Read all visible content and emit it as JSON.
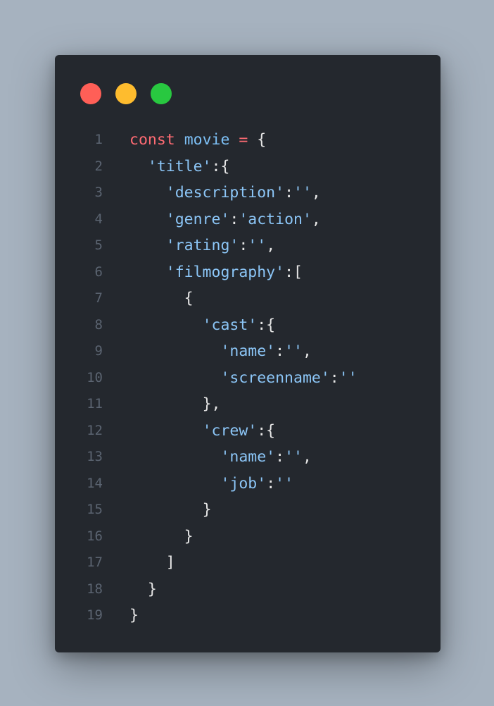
{
  "window": {
    "controls": [
      {
        "name": "close-dot",
        "color": "#ff5f57"
      },
      {
        "name": "minimize-dot",
        "color": "#febc2e"
      },
      {
        "name": "maximize-dot",
        "color": "#28c840"
      }
    ]
  },
  "colors": {
    "keyword": "#ff6b73",
    "variable": "#7dc0f6",
    "string": "#8cc6f7",
    "punctuation": "#e6e6e6",
    "line_number": "#5b6471",
    "background": "#24282e",
    "page_background": "#a6b2bf"
  },
  "code": {
    "language": "javascript",
    "lines": [
      {
        "number": "1",
        "indent": "",
        "tokens": [
          {
            "t": "const",
            "k": "keyword"
          },
          {
            "t": " ",
            "k": "punct"
          },
          {
            "t": "movie",
            "k": "variable"
          },
          {
            "t": " ",
            "k": "punct"
          },
          {
            "t": "=",
            "k": "operator"
          },
          {
            "t": " {",
            "k": "punct"
          }
        ]
      },
      {
        "number": "2",
        "indent": "  ",
        "tokens": [
          {
            "t": "'title'",
            "k": "string"
          },
          {
            "t": ":{",
            "k": "punct"
          }
        ]
      },
      {
        "number": "3",
        "indent": "    ",
        "tokens": [
          {
            "t": "'description'",
            "k": "string"
          },
          {
            "t": ":",
            "k": "punct"
          },
          {
            "t": "''",
            "k": "string"
          },
          {
            "t": ",",
            "k": "punct"
          }
        ]
      },
      {
        "number": "4",
        "indent": "    ",
        "tokens": [
          {
            "t": "'genre'",
            "k": "string"
          },
          {
            "t": ":",
            "k": "punct"
          },
          {
            "t": "'action'",
            "k": "string"
          },
          {
            "t": ",",
            "k": "punct"
          }
        ]
      },
      {
        "number": "5",
        "indent": "    ",
        "tokens": [
          {
            "t": "'rating'",
            "k": "string"
          },
          {
            "t": ":",
            "k": "punct"
          },
          {
            "t": "''",
            "k": "string"
          },
          {
            "t": ",",
            "k": "punct"
          }
        ]
      },
      {
        "number": "6",
        "indent": "    ",
        "tokens": [
          {
            "t": "'filmography'",
            "k": "string"
          },
          {
            "t": ":[",
            "k": "punct"
          }
        ]
      },
      {
        "number": "7",
        "indent": "      ",
        "tokens": [
          {
            "t": "{",
            "k": "punct"
          }
        ]
      },
      {
        "number": "8",
        "indent": "        ",
        "tokens": [
          {
            "t": "'cast'",
            "k": "string"
          },
          {
            "t": ":{",
            "k": "punct"
          }
        ]
      },
      {
        "number": "9",
        "indent": "          ",
        "tokens": [
          {
            "t": "'name'",
            "k": "string"
          },
          {
            "t": ":",
            "k": "punct"
          },
          {
            "t": "''",
            "k": "string"
          },
          {
            "t": ",",
            "k": "punct"
          }
        ]
      },
      {
        "number": "10",
        "indent": "          ",
        "tokens": [
          {
            "t": "'screenname'",
            "k": "string"
          },
          {
            "t": ":",
            "k": "punct"
          },
          {
            "t": "''",
            "k": "string"
          }
        ]
      },
      {
        "number": "11",
        "indent": "        ",
        "tokens": [
          {
            "t": "},",
            "k": "punct"
          }
        ]
      },
      {
        "number": "12",
        "indent": "        ",
        "tokens": [
          {
            "t": "'crew'",
            "k": "string"
          },
          {
            "t": ":{",
            "k": "punct"
          }
        ]
      },
      {
        "number": "13",
        "indent": "          ",
        "tokens": [
          {
            "t": "'name'",
            "k": "string"
          },
          {
            "t": ":",
            "k": "punct"
          },
          {
            "t": "''",
            "k": "string"
          },
          {
            "t": ",",
            "k": "punct"
          }
        ]
      },
      {
        "number": "14",
        "indent": "          ",
        "tokens": [
          {
            "t": "'job'",
            "k": "string"
          },
          {
            "t": ":",
            "k": "punct"
          },
          {
            "t": "''",
            "k": "string"
          }
        ]
      },
      {
        "number": "15",
        "indent": "        ",
        "tokens": [
          {
            "t": "}",
            "k": "punct"
          }
        ]
      },
      {
        "number": "16",
        "indent": "      ",
        "tokens": [
          {
            "t": "}",
            "k": "punct"
          }
        ]
      },
      {
        "number": "17",
        "indent": "    ",
        "tokens": [
          {
            "t": "]",
            "k": "punct"
          }
        ]
      },
      {
        "number": "18",
        "indent": "  ",
        "tokens": [
          {
            "t": "}",
            "k": "punct"
          }
        ]
      },
      {
        "number": "19",
        "indent": "",
        "tokens": [
          {
            "t": "}",
            "k": "punct"
          }
        ]
      }
    ]
  }
}
